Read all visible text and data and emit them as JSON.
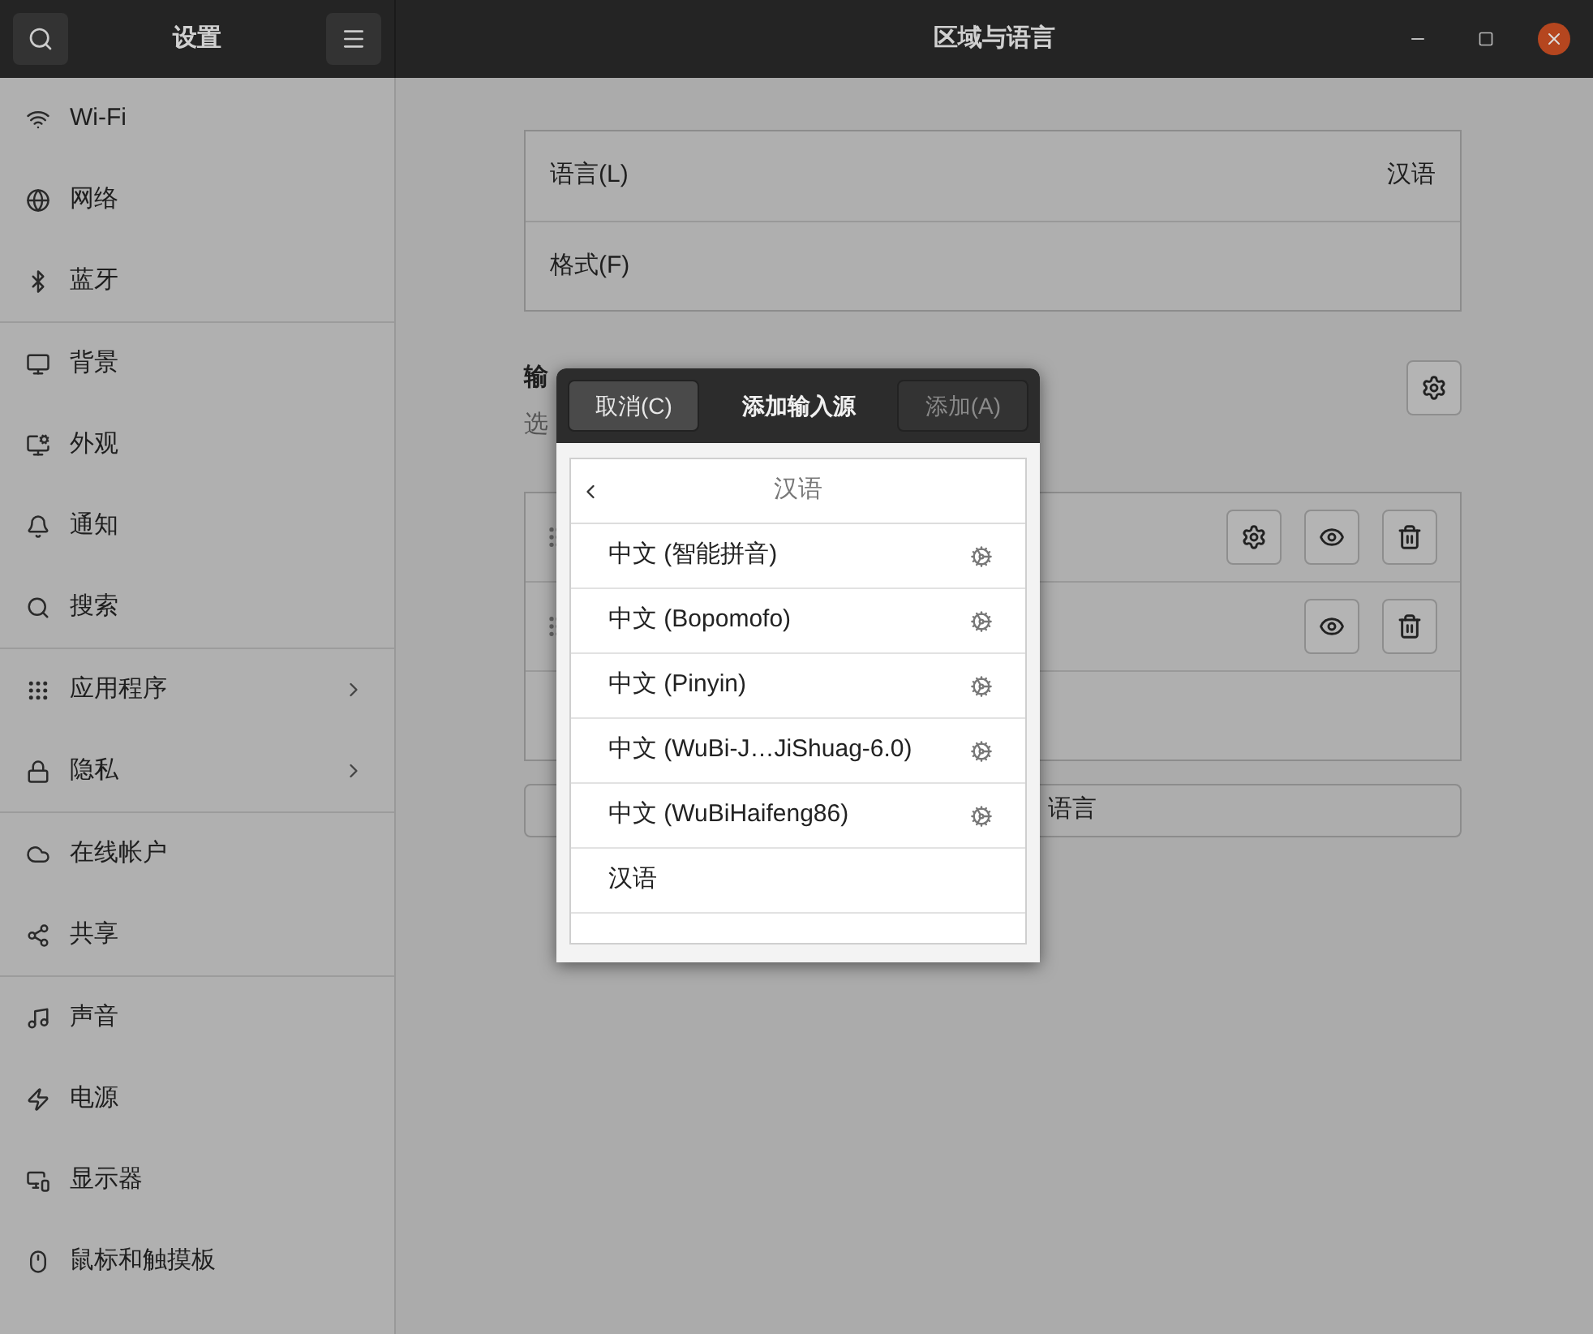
{
  "sidebar": {
    "title": "设置",
    "groups": [
      {
        "items": [
          {
            "label": "Wi-Fi",
            "has_submenu": false
          },
          {
            "label": "网络",
            "has_submenu": false
          },
          {
            "label": "蓝牙",
            "has_submenu": false
          }
        ]
      },
      {
        "items": [
          {
            "label": "背景",
            "has_submenu": false
          },
          {
            "label": "外观",
            "has_submenu": false
          },
          {
            "label": "通知",
            "has_submenu": false
          },
          {
            "label": "搜索",
            "has_submenu": false
          }
        ]
      },
      {
        "items": [
          {
            "label": "应用程序",
            "has_submenu": true
          },
          {
            "label": "隐私",
            "has_submenu": true
          }
        ]
      },
      {
        "items": [
          {
            "label": "在线帐户",
            "has_submenu": false
          },
          {
            "label": "共享",
            "has_submenu": false
          }
        ]
      },
      {
        "items": [
          {
            "label": "声音",
            "has_submenu": false
          },
          {
            "label": "电源",
            "has_submenu": false
          },
          {
            "label": "显示器",
            "has_submenu": false
          },
          {
            "label": "鼠标和触摸板",
            "has_submenu": false
          }
        ]
      }
    ]
  },
  "window": {
    "title": "区域与语言"
  },
  "language_settings": [
    {
      "label": "语言(L)",
      "value": "汉语"
    },
    {
      "label": "格式(F)"
    }
  ],
  "input_sources": {
    "title": "输",
    "subtitle": "选",
    "rows": [
      {
        "configurable": true
      },
      {
        "configurable": false
      }
    ],
    "add_language_button": "语言"
  },
  "dialog": {
    "cancel": "取消(C)",
    "title": "添加输入源",
    "add": "添加(A)",
    "add_disabled": true,
    "list_header": "汉语",
    "items": [
      {
        "label": "中文 (智能拼音)",
        "configurable": true
      },
      {
        "label": "中文 (Bopomofo)",
        "configurable": true
      },
      {
        "label": "中文 (Pinyin)",
        "configurable": true
      },
      {
        "label": "中文 (WuBi-J…JiShuag-6.0)",
        "configurable": true
      },
      {
        "label": "中文 (WuBiHaifeng86)",
        "configurable": true
      },
      {
        "label": "汉语",
        "configurable": false
      }
    ]
  }
}
